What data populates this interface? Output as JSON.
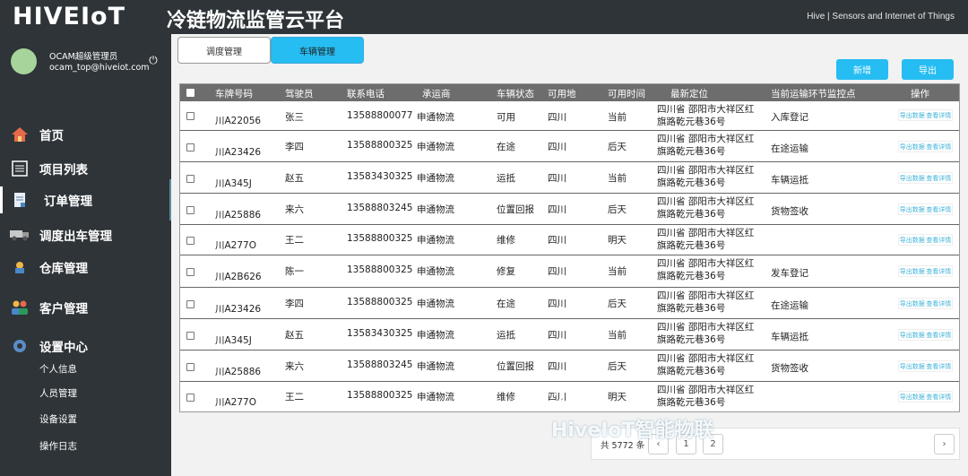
{
  "header": {
    "logo": "HIVEIoT",
    "title": "冷链物流监管云平台",
    "tagline": "Hive | Sensors and Internet of Things"
  },
  "user": {
    "name": "OCAM超级管理员",
    "email": "ocam_top@hiveiot.com"
  },
  "sidebar": {
    "items": [
      {
        "label": "首页",
        "icon": "home-icon"
      },
      {
        "label": "项目列表",
        "icon": "list-icon"
      },
      {
        "label": "订单管理",
        "icon": "document-icon"
      },
      {
        "label": "调度出车管理",
        "icon": "truck-icon"
      },
      {
        "label": "仓库管理",
        "icon": "warehouse-icon"
      },
      {
        "label": "客户管理",
        "icon": "users-icon"
      },
      {
        "label": "设置中心",
        "icon": "gear-icon"
      }
    ],
    "sub_items": [
      "个人信息",
      "人员管理",
      "设备设置",
      "操作日志"
    ]
  },
  "tabs": [
    {
      "label": "调度管理"
    },
    {
      "label": "车辆管理"
    }
  ],
  "toolbar": {
    "add_label": "新增",
    "export_label": "导出"
  },
  "table": {
    "columns": [
      "车牌号码",
      "驾驶员",
      "联系电话",
      "承运商",
      "车辆状态",
      "可用地",
      "可用时间",
      "最新定位",
      "当前运输环节监控点",
      "操作"
    ],
    "rows": [
      {
        "plate": "川A22056",
        "driver": "张三",
        "phone": "13588800077",
        "carrier": "申通物流",
        "status": "可用",
        "area": "四川",
        "time": "当前",
        "loc1": "四川省 邵阳市大祥区红",
        "loc2": "旗路乾元巷36号",
        "point": "入库登记"
      },
      {
        "plate": "川A23426",
        "driver": "李四",
        "phone": "13588800325",
        "carrier": "申通物流",
        "status": "在途",
        "area": "四川",
        "time": "后天",
        "loc1": "四川省 邵阳市大祥区红",
        "loc2": "旗路乾元巷36号",
        "point": "在途运输"
      },
      {
        "plate": "川A345J",
        "driver": "赵五",
        "phone": "13583430325",
        "carrier": "申通物流",
        "status": "运抵",
        "area": "四川",
        "time": "当前",
        "loc1": "四川省 邵阳市大祥区红",
        "loc2": "旗路乾元巷36号",
        "point": "车辆运抵"
      },
      {
        "plate": "川A25886",
        "driver": "来六",
        "phone": "13588803245",
        "carrier": "申通物流",
        "status": "位置回报",
        "area": "四川",
        "time": "后天",
        "loc1": "四川省 邵阳市大祥区红",
        "loc2": "旗路乾元巷36号",
        "point": "货物签收"
      },
      {
        "plate": "川A277O",
        "driver": "王二",
        "phone": "13588800325",
        "carrier": "申通物流",
        "status": "维修",
        "area": "四川",
        "time": "明天",
        "loc1": "四川省 邵阳市大祥区红",
        "loc2": "旗路乾元巷36号",
        "point": ""
      },
      {
        "plate": "川A2B626",
        "driver": "陈一",
        "phone": "13588800325",
        "carrier": "申通物流",
        "status": "修复",
        "area": "四川",
        "time": "当前",
        "loc1": "四川省 邵阳市大祥区红",
        "loc2": "旗路乾元巷36号",
        "point": "发车登记"
      },
      {
        "plate": "川A23426",
        "driver": "李四",
        "phone": "13588800325",
        "carrier": "申通物流",
        "status": "在途",
        "area": "四川",
        "time": "后天",
        "loc1": "四川省 邵阳市大祥区红",
        "loc2": "旗路乾元巷36号",
        "point": "在途运输"
      },
      {
        "plate": "川A345J",
        "driver": "赵五",
        "phone": "13583430325",
        "carrier": "申通物流",
        "status": "运抵",
        "area": "四川",
        "time": "当前",
        "loc1": "四川省 邵阳市大祥区红",
        "loc2": "旗路乾元巷36号",
        "point": "车辆运抵"
      },
      {
        "plate": "川A25886",
        "driver": "来六",
        "phone": "13588803245",
        "carrier": "申通物流",
        "status": "位置回报",
        "area": "四川",
        "time": "后天",
        "loc1": "四川省 邵阳市大祥区红",
        "loc2": "旗路乾元巷36号",
        "point": "货物签收"
      },
      {
        "plate": "川A277O",
        "driver": "王二",
        "phone": "13588800325",
        "carrier": "申通物流",
        "status": "维修",
        "area": "四川",
        "time": "明天",
        "loc1": "四川省 邵阳市大祥区红",
        "loc2": "旗路乾元巷36号",
        "point": ""
      }
    ],
    "op_labels": [
      "导出数据",
      "查看详情"
    ]
  },
  "pager": {
    "total": "共 5772 条",
    "current_page": "1",
    "next_page": "2"
  },
  "watermark": "HiveIoT智能物联",
  "colors": {
    "accent": "#26bdf2",
    "sidebar_bg": "#2e3438",
    "table_header_bg": "#6d6d6d"
  }
}
